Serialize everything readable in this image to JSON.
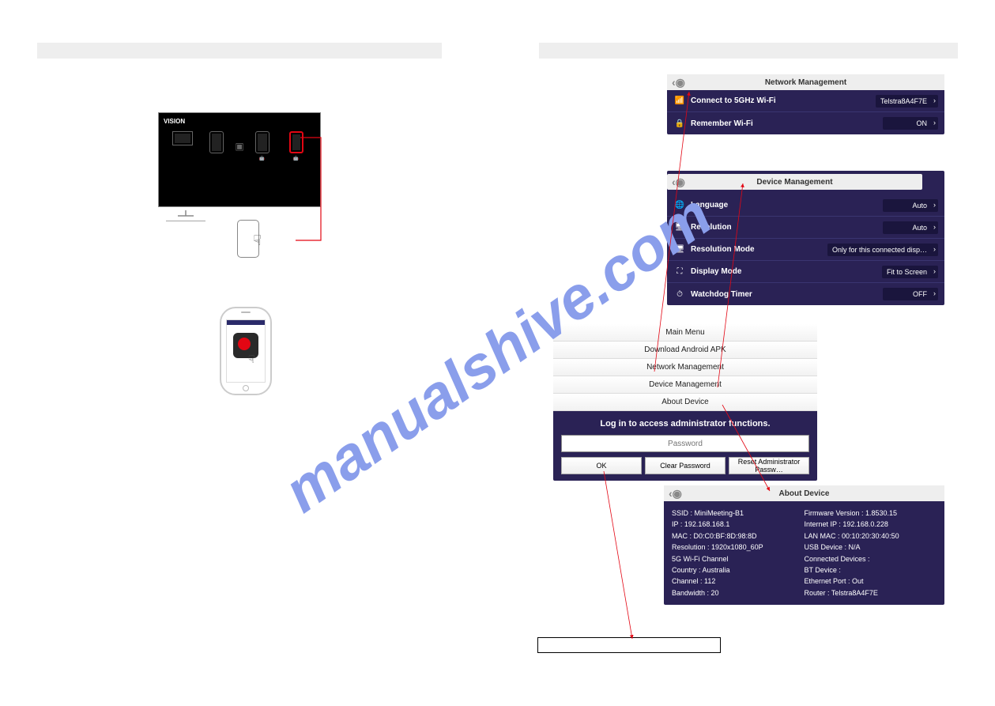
{
  "watermark": "manualshive.com",
  "tv": {
    "brand": "VISION"
  },
  "network_panel": {
    "title": "Network Management",
    "row1_label": "Connect to 5GHz Wi-Fi",
    "row1_value": "Telstra8A4F7E",
    "row2_label": "Remember Wi-Fi",
    "row2_value": "ON"
  },
  "device_panel": {
    "title": "Device Management",
    "rows": [
      {
        "icon": "🌐",
        "label": "Language",
        "value": "Auto"
      },
      {
        "icon": "🖥",
        "label": "Resolution",
        "value": "Auto"
      },
      {
        "icon": "🖥",
        "label": "Resolution Mode",
        "value": "Only for this connected disp…"
      },
      {
        "icon": "⛶",
        "label": "Display Mode",
        "value": "Fit to Screen"
      },
      {
        "icon": "⏱",
        "label": "Watchdog Timer",
        "value": "OFF"
      }
    ]
  },
  "menu": {
    "items": [
      "Main Menu",
      "Download Android APK",
      "Network Management",
      "Device Management",
      "About Device"
    ],
    "login_msg": "Log in to access administrator functions.",
    "placeholder": "Password",
    "btn_ok": "OK",
    "btn_clear": "Clear Password",
    "btn_reset": "Reset Administrator Passw…"
  },
  "about": {
    "title": "About Device",
    "left": {
      "ssid": "SSID : MiniMeeting-B1",
      "ip": "IP : 192.168.168.1",
      "mac": "MAC : D0:C0:BF:8D:98:8D",
      "res": "Resolution : 1920x1080_60P",
      "wifi_hdr": "5G Wi-Fi Channel",
      "country": "Country : Australia",
      "channel": "Channel : 112",
      "bw": "Bandwidth : 20"
    },
    "right": {
      "fw": "Firmware Version : 1.8530.15",
      "iip": "Internet IP : 192.168.0.228",
      "lanmac": "LAN MAC : 00:10:20:30:40:50",
      "usb": "USB Device : N/A",
      "conn": "Connected Devices :",
      "bt": "BT Device :",
      "eth": "Ethernet Port : Out",
      "router": "Router : Telstra8A4F7E"
    }
  }
}
